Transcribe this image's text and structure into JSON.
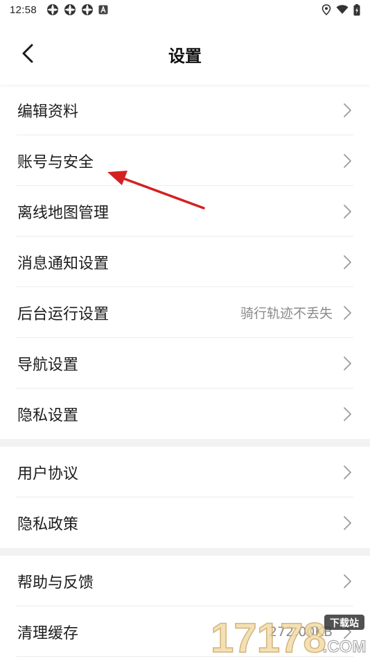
{
  "status_bar": {
    "time": "12:58",
    "icons_left": [
      "app-icon",
      "app-icon",
      "app-icon",
      "a-icon"
    ],
    "icons_right": [
      "location-icon",
      "wifi-icon",
      "battery-charging-icon"
    ]
  },
  "header": {
    "title": "设置",
    "back_icon": "chevron-left-icon"
  },
  "groups": [
    {
      "items": [
        {
          "label": "编辑资料",
          "value": ""
        },
        {
          "label": "账号与安全",
          "value": ""
        },
        {
          "label": "离线地图管理",
          "value": ""
        },
        {
          "label": "消息通知设置",
          "value": ""
        },
        {
          "label": "后台运行设置",
          "value": "骑行轨迹不丢失"
        },
        {
          "label": "导航设置",
          "value": ""
        },
        {
          "label": "隐私设置",
          "value": ""
        }
      ]
    },
    {
      "items": [
        {
          "label": "用户协议",
          "value": ""
        },
        {
          "label": "隐私政策",
          "value": ""
        }
      ]
    },
    {
      "items": [
        {
          "label": "帮助与反馈",
          "value": ""
        },
        {
          "label": "清理缓存",
          "value": "272.00KB"
        }
      ]
    }
  ],
  "watermark": {
    "number": "17178",
    "badge": "下载站",
    "domain": ".COM"
  },
  "colors": {
    "annotation_arrow": "#d42020",
    "section_gap": "#f2f2f2",
    "secondary_text": "#8a8a8a"
  }
}
